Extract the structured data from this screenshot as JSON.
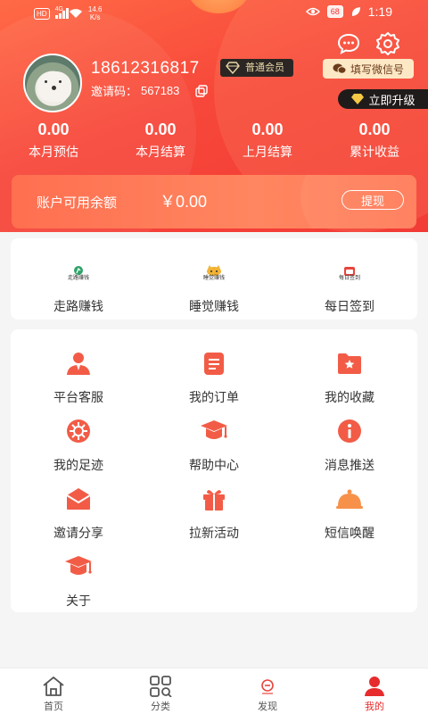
{
  "status_bar": {
    "network_badge": "HD",
    "signal_label": "4G",
    "net_speed_value": "14.6",
    "net_speed_unit": "K/s",
    "battery": "68",
    "time": "1:19"
  },
  "profile": {
    "phone": "18612316817",
    "member_level": "普通会员",
    "invite_label": "邀请码：",
    "invite_code": "567183",
    "wechat_button": "填写微信号",
    "upgrade_button": "立即升级"
  },
  "stats": [
    {
      "value": "0.00",
      "label": "本月预估"
    },
    {
      "value": "0.00",
      "label": "本月结算"
    },
    {
      "value": "0.00",
      "label": "上月结算"
    },
    {
      "value": "0.00",
      "label": "累计收益"
    }
  ],
  "balance": {
    "label": "账户可用余额",
    "value": "￥0.00",
    "withdraw_button": "提现"
  },
  "earn_tasks": [
    {
      "label": "走路赚钱",
      "mini": "走路赚钱",
      "icon": "walking-icon"
    },
    {
      "label": "睡觉赚钱",
      "mini": "睡觉赚钱",
      "icon": "sleep-icon"
    },
    {
      "label": "每日签到",
      "mini": "每日签到",
      "icon": "checkin-icon"
    }
  ],
  "menu": [
    {
      "label": "平台客服",
      "icon": "customer-service-icon"
    },
    {
      "label": "我的订单",
      "icon": "order-icon"
    },
    {
      "label": "我的收藏",
      "icon": "favorites-icon"
    },
    {
      "label": "我的足迹",
      "icon": "footprint-icon"
    },
    {
      "label": "帮助中心",
      "icon": "help-icon"
    },
    {
      "label": "消息推送",
      "icon": "info-icon"
    },
    {
      "label": "邀请分享",
      "icon": "invite-icon"
    },
    {
      "label": "拉新活动",
      "icon": "gift-icon"
    },
    {
      "label": "短信唤醒",
      "icon": "bell-icon"
    },
    {
      "label": "关于",
      "icon": "about-icon"
    }
  ],
  "tabs": [
    {
      "label": "首页",
      "icon": "home-icon"
    },
    {
      "label": "分类",
      "icon": "category-icon"
    },
    {
      "label": "发现",
      "icon": "discover-icon"
    },
    {
      "label": "我的",
      "icon": "profile-icon"
    }
  ],
  "colors": {
    "brand": "#f24a3a",
    "active_tab": "#e62c2c",
    "gold": "#e9d8a8"
  }
}
